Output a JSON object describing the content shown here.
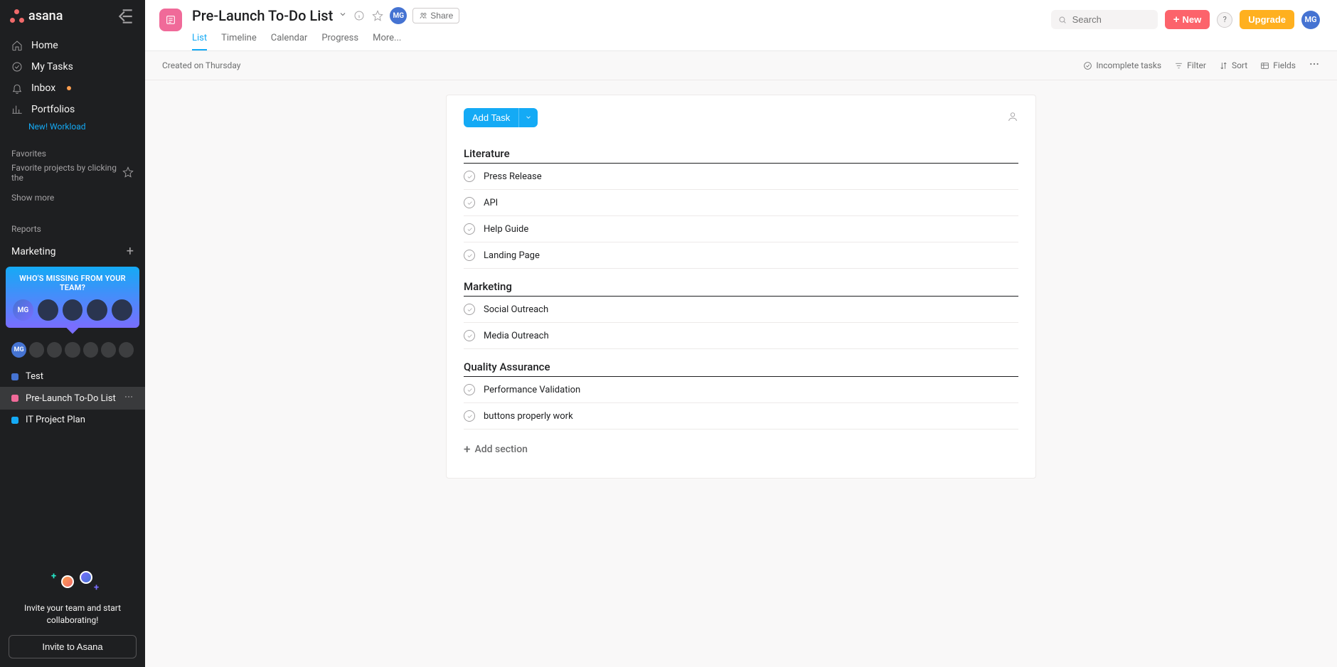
{
  "brand": "asana",
  "nav": {
    "home": "Home",
    "my_tasks": "My Tasks",
    "inbox": "Inbox",
    "portfolios": "Portfolios",
    "workload": "New! Workload"
  },
  "favorites": {
    "header": "Favorites",
    "hint": "Favorite projects by clicking the",
    "show_more": "Show more"
  },
  "reports_header": "Reports",
  "team": {
    "name": "Marketing",
    "promo_title": "WHO'S MISSING FROM YOUR TEAM?"
  },
  "user_initials": "MG",
  "projects": [
    {
      "name": "Test",
      "color": "#4573d2"
    },
    {
      "name": "Pre-Launch To-Do List",
      "color": "#f06a99"
    },
    {
      "name": "IT Project Plan",
      "color": "#14aaf5"
    }
  ],
  "invite": {
    "text": "Invite your team and start collaborating!",
    "button": "Invite to Asana"
  },
  "header": {
    "title": "Pre-Launch To-Do List",
    "share": "Share",
    "tabs": [
      "List",
      "Timeline",
      "Calendar",
      "Progress",
      "More..."
    ],
    "search_placeholder": "Search",
    "new": "New",
    "upgrade": "Upgrade"
  },
  "toolbar": {
    "created": "Created on Thursday",
    "incomplete": "Incomplete tasks",
    "filter": "Filter",
    "sort": "Sort",
    "fields": "Fields"
  },
  "panel": {
    "add_task": "Add Task",
    "add_section": "Add section"
  },
  "sections": [
    {
      "title": "Literature",
      "tasks": [
        "Press Release",
        "API",
        "Help Guide",
        "Landing Page"
      ]
    },
    {
      "title": "Marketing",
      "tasks": [
        "Social Outreach",
        "Media Outreach"
      ]
    },
    {
      "title": "Quality Assurance",
      "tasks": [
        "Performance Validation",
        "buttons properly work"
      ]
    }
  ]
}
